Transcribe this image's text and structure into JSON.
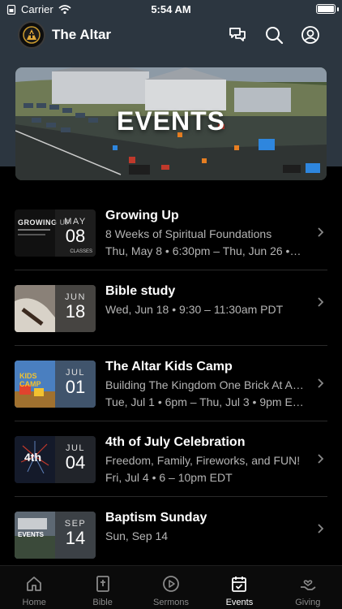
{
  "status_bar": {
    "carrier": "Carrier",
    "time": "5:54 AM"
  },
  "header": {
    "title": "The Altar"
  },
  "hero": {
    "title": "EVENTS"
  },
  "events": [
    {
      "title": "Growing Up",
      "line1": "8 Weeks of Spiritual Foundations",
      "line2": "Thu, May 8 • 6:30pm – Thu, Jun 26 •…",
      "month": "MAY",
      "day": "08",
      "sub": "CLASSES",
      "thumb_text": "GROWING UP"
    },
    {
      "title": "Bible study",
      "line1": "Wed, Jun 18 • 9:30 – 11:30am PDT",
      "line2": "",
      "month": "JUN",
      "day": "18"
    },
    {
      "title": "The Altar Kids Camp",
      "line1": "Building The Kingdom One Brick At A…",
      "line2": "Tue, Jul 1 • 6pm – Thu, Jul 3 • 9pm E…",
      "month": "JUL",
      "day": "01",
      "thumb_text": "KIDS CAMP"
    },
    {
      "title": "4th of July Celebration",
      "line1": "Freedom, Family, Fireworks, and FUN!",
      "line2": "Fri, Jul 4 • 6 – 10pm EDT",
      "month": "JUL",
      "day": "04",
      "thumb_text": "4th"
    },
    {
      "title": "Baptism Sunday",
      "line1": "Sun, Sep 14",
      "line2": "",
      "month": "SEP",
      "day": "14",
      "thumb_text": "EVENTS"
    }
  ],
  "tabs": [
    {
      "label": "Home",
      "icon": "home-icon"
    },
    {
      "label": "Bible",
      "icon": "bible-icon"
    },
    {
      "label": "Sermons",
      "icon": "play-icon"
    },
    {
      "label": "Events",
      "icon": "calendar-icon",
      "active": true
    },
    {
      "label": "Giving",
      "icon": "giving-icon"
    }
  ]
}
